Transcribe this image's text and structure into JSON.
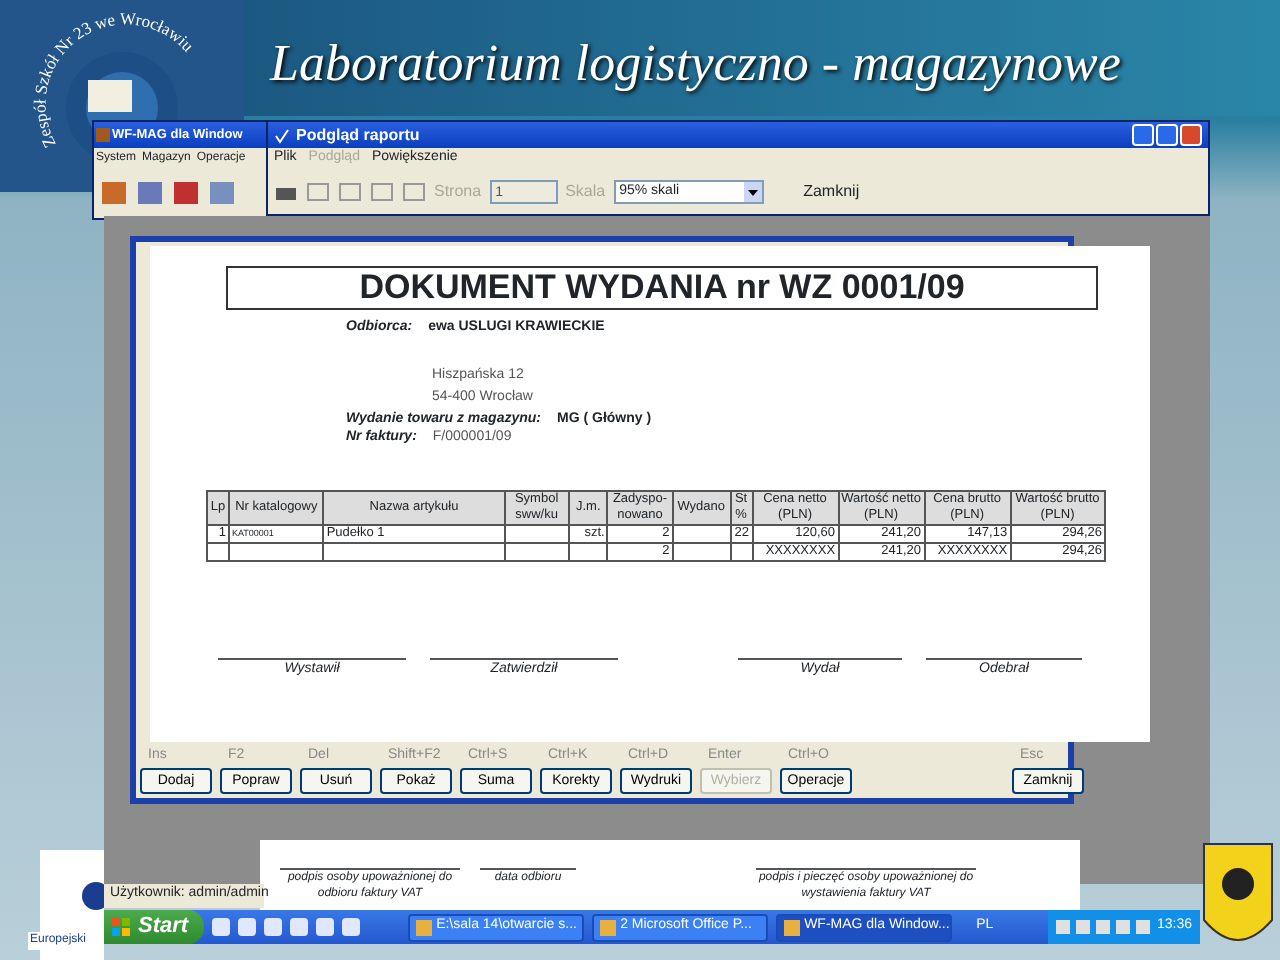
{
  "slide": {
    "title": "Laboratorium logistyczno - magazynowe",
    "logo_text": "Zespół Szkół Nr 23 we Wrocławiu",
    "footer_logo_text": "Europejski"
  },
  "main_window": {
    "title": "WF-MAG dla Window",
    "menu": [
      "System",
      "Magazyn",
      "Operacje"
    ]
  },
  "report_window": {
    "title": "Podgląd raportu",
    "menu": [
      {
        "label": "Plik",
        "disabled": false
      },
      {
        "label": "Podgląd",
        "disabled": true
      },
      {
        "label": "Powiększenie",
        "disabled": false
      }
    ],
    "page": {
      "label": "Strona",
      "value": "1",
      "disabled": true
    },
    "scale": {
      "label": "Skala",
      "value": "95% skali",
      "disabled": true
    },
    "close_label": "Zamknij"
  },
  "document": {
    "title": "DOKUMENT WYDANIA nr WZ 0001/09",
    "recipient_label": "Odbiorca:",
    "recipient": "ewa USLUGI KRAWIECKIE",
    "address": [
      "Hiszpańska 12",
      "54-400 Wrocław"
    ],
    "warehouse_label": "Wydanie towaru z magazynu:",
    "warehouse": "MG ( Główny )",
    "invoice_label": "Nr faktury:",
    "invoice": "F/000001/09",
    "table": {
      "columns": [
        "Lp",
        "Nr katalogowy",
        "Nazwa artykułu",
        "Symbol sww/ku",
        "J.m.",
        "Zadyspo-nowano",
        "Wydano",
        "St %",
        "Cena netto (PLN)",
        "Wartość netto (PLN)",
        "Cena brutto (PLN)",
        "Wartość brutto (PLN)"
      ],
      "rows": [
        [
          "1",
          "KAT00001",
          "Pudełko  1",
          "",
          "szt.",
          "2",
          "",
          "22",
          "120,60",
          "241,20",
          "147,13",
          "294,26"
        ]
      ],
      "total": {
        "ordered": "2",
        "net_price": "XXXXXXXX",
        "net_value": "241,20",
        "gross_price": "XXXXXXXX",
        "gross_value": "294,26"
      }
    },
    "signatures": [
      "Wystawił",
      "Zatwierdził",
      "Wydał",
      "Odebrał"
    ]
  },
  "buttons": [
    {
      "key": "Ins",
      "label": "Dodaj",
      "disabled": false
    },
    {
      "key": "F2",
      "label": "Popraw",
      "disabled": false
    },
    {
      "key": "Del",
      "label": "Usuń",
      "disabled": false
    },
    {
      "key": "Shift+F2",
      "label": "Pokaż",
      "disabled": false
    },
    {
      "key": "Ctrl+S",
      "label": "Suma",
      "disabled": false
    },
    {
      "key": "Ctrl+K",
      "label": "Korekty",
      "disabled": false
    },
    {
      "key": "Ctrl+D",
      "label": "Wydruki",
      "disabled": false
    },
    {
      "key": "Enter",
      "label": "Wybierz",
      "disabled": true
    },
    {
      "key": "Ctrl+O",
      "label": "Operacje",
      "disabled": false
    },
    {
      "key": "Esc",
      "label": "Zamknij",
      "disabled": false
    }
  ],
  "invoice_paper": {
    "signatures": [
      "podpis osoby upoważnionej do odbioru faktury VAT",
      "data odbioru",
      "podpis i pieczęć osoby upoważnionej do wystawienia faktury VAT"
    ]
  },
  "status_bar": {
    "user": "Użytkownik: admin/admin"
  },
  "taskbar": {
    "start": "Start",
    "tasks": [
      {
        "label": "E:\\sala 14\\otwarcie s...",
        "selected": false
      },
      {
        "label": "2 Microsoft Office P...",
        "selected": false
      },
      {
        "label": "WF-MAG dla Window...",
        "selected": true
      }
    ],
    "language": "PL",
    "clock": "13:36"
  }
}
